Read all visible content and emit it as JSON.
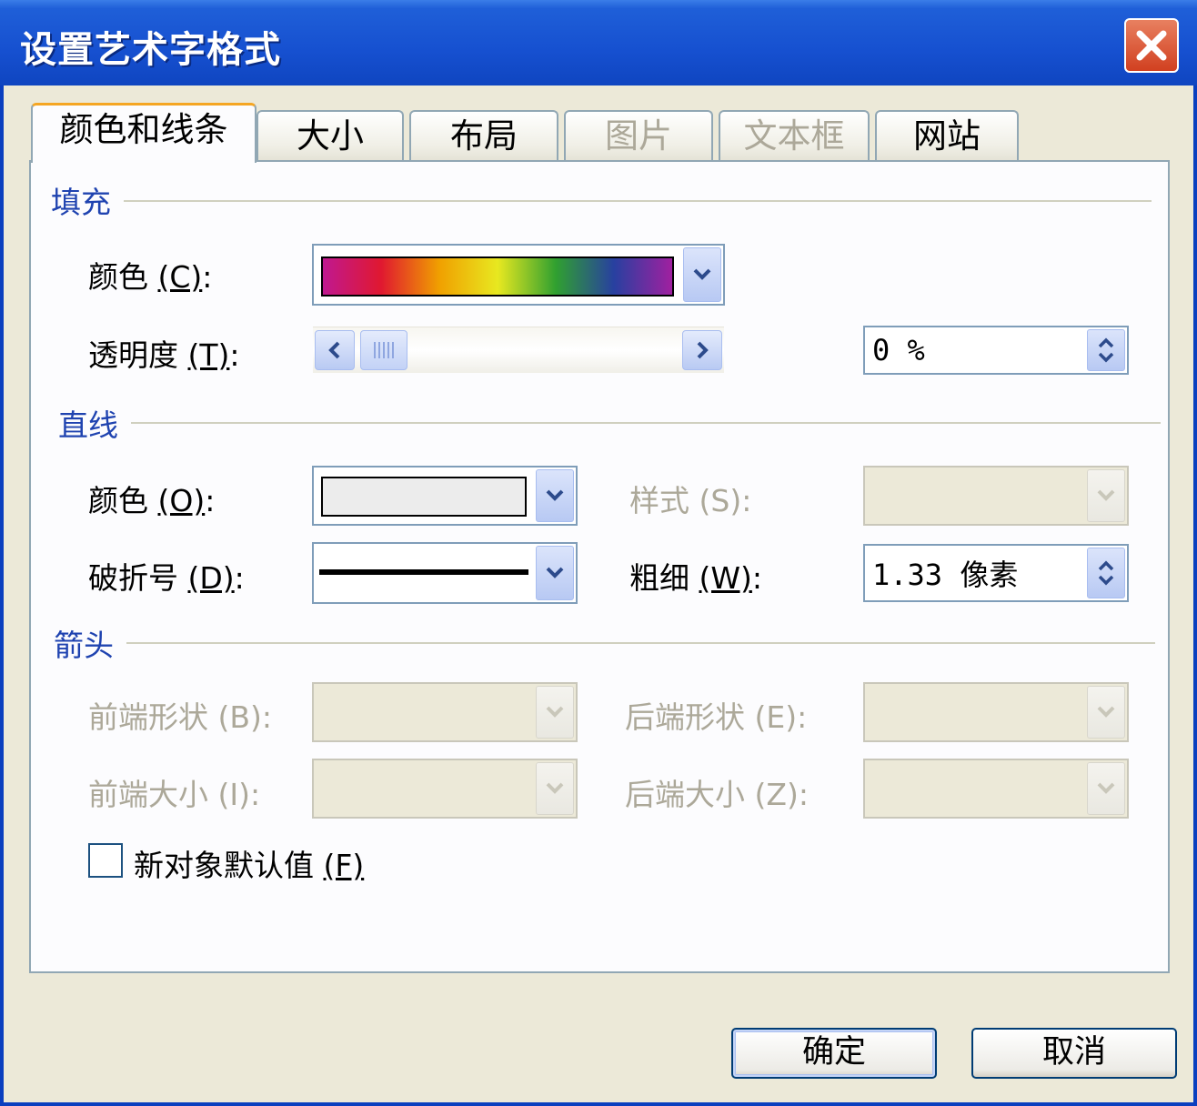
{
  "window": {
    "title": "设置艺术字格式"
  },
  "tabs": [
    {
      "label": "颜色和线条",
      "state": "active"
    },
    {
      "label": "大小",
      "state": "enabled"
    },
    {
      "label": "布局",
      "state": "enabled"
    },
    {
      "label": "图片",
      "state": "disabled"
    },
    {
      "label": "文本框",
      "state": "disabled"
    },
    {
      "label": "网站",
      "state": "enabled"
    }
  ],
  "fill": {
    "group_label": "填充",
    "color_label": "颜色",
    "color_accel": "(C)",
    "color_gradient": [
      "#c01890",
      "#e01830",
      "#f0a000",
      "#e8e820",
      "#30a030",
      "#2840a0",
      "#a020a0"
    ],
    "transparency_label": "透明度",
    "transparency_accel": "(T)",
    "transparency_value": "0 %",
    "transparency_level": 0
  },
  "line": {
    "group_label": "直线",
    "color_label": "颜色",
    "color_accel": "(O)",
    "color_swatch": "#ececec",
    "style_label": "样式",
    "style_accel": "(S)",
    "dash_label": "破折号",
    "dash_accel": "(D)",
    "weight_label": "粗细",
    "weight_accel": "(W)",
    "weight_value": "1.33 像素"
  },
  "arrows": {
    "group_label": "箭头",
    "begin_style_label": "前端形状",
    "begin_style_accel": "(B)",
    "end_style_label": "后端形状",
    "end_style_accel": "(E)",
    "begin_size_label": "前端大小",
    "begin_size_accel": "(I)",
    "end_size_label": "后端大小",
    "end_size_accel": "(Z)"
  },
  "default_checkbox": {
    "label": "新对象默认值",
    "accel": "(F)",
    "checked": false
  },
  "buttons": {
    "ok": "确定",
    "cancel": "取消"
  },
  "colors": {
    "title_bar": "#1650d0",
    "close": "#d14020",
    "group_label": "#1f43b0",
    "disabled_text": "#aca899"
  }
}
